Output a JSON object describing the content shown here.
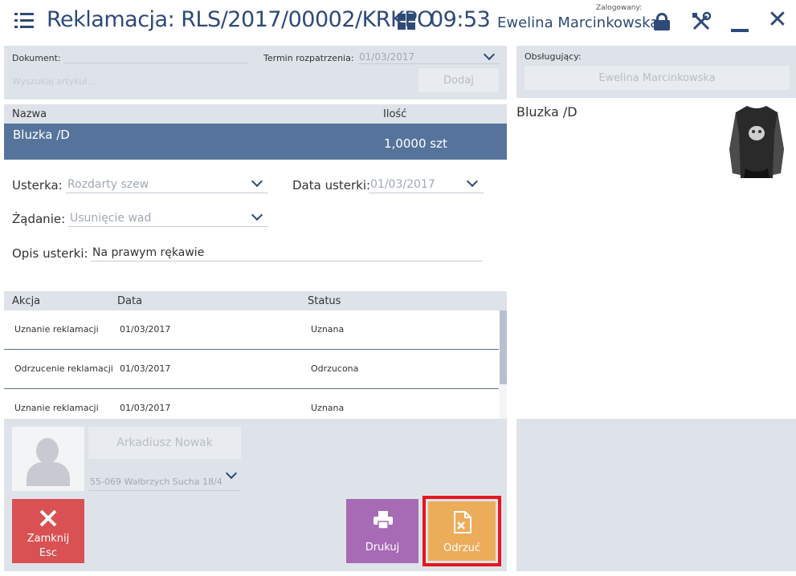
{
  "header": {
    "title": "Reklamacja: RLS/2017/00002/KRKPO",
    "time": "09:53",
    "logged_label": "Zalogowany:",
    "user": "Ewelina Marcinkowska",
    "accent_color": "#2e4a78"
  },
  "document": {
    "label": "Dokument:",
    "term_label": "Termin rozpatrzenia:",
    "term_value": "01/03/2017",
    "search_placeholder": "Wyszukaj artykuł...",
    "add_label": "Dodaj"
  },
  "items": {
    "headers": [
      "Nazwa",
      "Ilość"
    ],
    "rows": [
      {
        "name": "Bluzka /D",
        "qty": "1,0000 szt"
      }
    ],
    "selected_color": "#56749b"
  },
  "defect": {
    "type_label": "Usterka:",
    "type_value": "Rozdarty szew",
    "date_label": "Data usterki:",
    "date_value": "01/03/2017",
    "request_label": "Żądanie:",
    "request_value": "Usunięcie wad",
    "desc_label": "Opis usterki:",
    "desc_value": "Na prawym rękawie"
  },
  "actions": {
    "headers": [
      "Akcja",
      "Data",
      "Status"
    ],
    "rows": [
      {
        "action": "Uznanie reklamacji",
        "date": "01/03/2017",
        "status": "Uznana"
      },
      {
        "action": "Odrzucenie reklamacji",
        "date": "01/03/2017",
        "status": "Odrzucona"
      },
      {
        "action": "Uznanie reklamacji",
        "date": "01/03/2017",
        "status": "Uznana"
      }
    ]
  },
  "customer": {
    "name": "Arkadiusz Nowak",
    "address": "55-069 Wałbrzych Sucha 18/4"
  },
  "buttons": {
    "close_label": "Zamknij",
    "close_shortcut": "Esc",
    "print_label": "Drukuj",
    "reject_label": "Odrzuć",
    "close_color": "#d95152",
    "print_color": "#a76ab5",
    "reject_color": "#ecad5a",
    "highlight_color": "#e6161f"
  },
  "right": {
    "resp_label": "Obsługujący:",
    "resp_value": "Ewelina Marcinkowska",
    "product_name": "Bluzka /D"
  }
}
